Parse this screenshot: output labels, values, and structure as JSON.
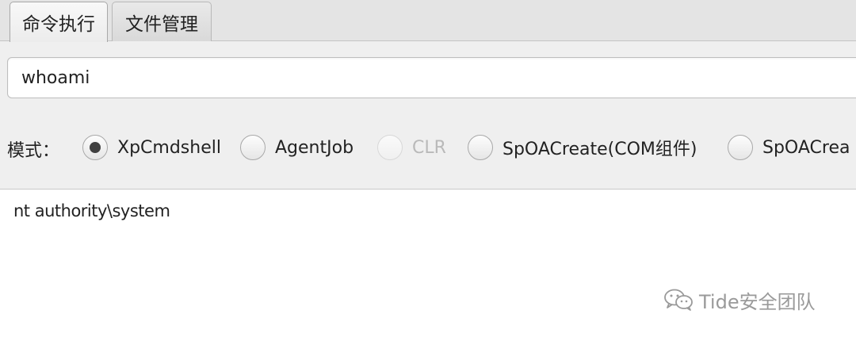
{
  "tabs": [
    {
      "label": "命令执行",
      "active": true
    },
    {
      "label": "文件管理",
      "active": false
    }
  ],
  "command": {
    "value": "whoami"
  },
  "mode": {
    "label": "模式：",
    "options": [
      {
        "label": "XpCmdshell",
        "selected": true,
        "disabled": false
      },
      {
        "label": "AgentJob",
        "selected": false,
        "disabled": false
      },
      {
        "label": "CLR",
        "selected": false,
        "disabled": true
      },
      {
        "label": "SpOACreate(COM组件)",
        "selected": false,
        "disabled": false
      },
      {
        "label": "SpOACrea",
        "selected": false,
        "disabled": false
      }
    ]
  },
  "output": {
    "text": "nt authority\\system"
  },
  "watermark": {
    "text": "Tide安全团队",
    "icon": "wechat-icon"
  }
}
